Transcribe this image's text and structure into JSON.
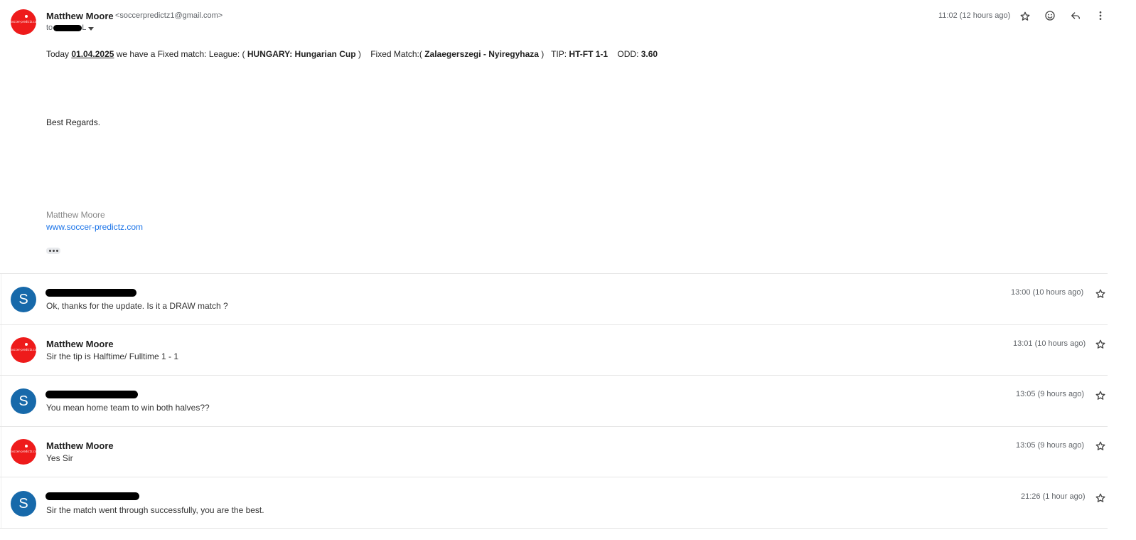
{
  "expanded_message": {
    "sender_name": "Matthew Moore",
    "sender_email": "<soccerpredictz1@gmail.com>",
    "to_prefix": "to",
    "to_suffix": "L",
    "time": "11:02 (12 hours ago)",
    "body": {
      "t1": "Today ",
      "date": "01.04.2025",
      "t2": " we have a Fixed match: League: ( ",
      "league": "HUNGARY: Hungarian Cup",
      "t3": " )    Fixed Match:( ",
      "match": "Zalaegerszegi - Nyiregyhaza",
      "t4": " )   TIP: ",
      "tip": "HT-FT 1-1",
      "t5": "    ODD: ",
      "odd": "3.60"
    },
    "regards": "Best Regards.",
    "signature_name": "Matthew Moore",
    "signature_link": "www.soccer-predictz.com",
    "logo_text": "soccer-predictz.com"
  },
  "messages": [
    {
      "sender": "",
      "snippet": "Ok, thanks for the update. Is it a DRAW match ?",
      "time": "13:00 (10 hours ago)",
      "avatar": "S"
    },
    {
      "sender": "Matthew Moore",
      "snippet": "Sir the tip is Halftime/ Fulltime 1 - 1",
      "time": "13:01 (10 hours ago)",
      "avatar": "logo"
    },
    {
      "sender": "",
      "snippet": "You mean home team to win both halves??",
      "time": "13:05 (9 hours ago)",
      "avatar": "S"
    },
    {
      "sender": "Matthew Moore",
      "snippet": "Yes Sir",
      "time": "13:05 (9 hours ago)",
      "avatar": "logo"
    },
    {
      "sender": "",
      "snippet": "Sir the match went through successfully, you are the best.",
      "time": "21:26 (1 hour ago)",
      "avatar": "S"
    }
  ],
  "icons": {
    "star": "star-icon",
    "emoji": "emoji-icon",
    "reply": "reply-icon",
    "more": "more-vert-icon"
  },
  "colors": {
    "logo_red": "#ee1b1b",
    "avatar_blue": "#1769aa",
    "link_blue": "#1a73e8"
  }
}
